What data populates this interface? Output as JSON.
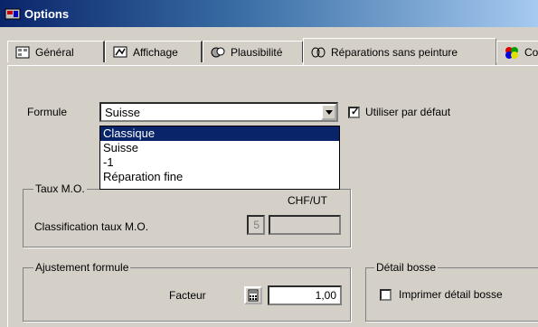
{
  "window": {
    "title": "Options"
  },
  "tabs": [
    {
      "label": "Général",
      "icon": "general-icon"
    },
    {
      "label": "Affichage",
      "icon": "display-icon"
    },
    {
      "label": "Plausibilité",
      "icon": "plausibility-icon"
    },
    {
      "label": "Réparations sans peinture",
      "icon": "repair-icon",
      "active": true
    },
    {
      "label": "Co",
      "icon": "color-icon"
    }
  ],
  "formule": {
    "label": "Formule",
    "value": "Suisse",
    "options": [
      "Classique",
      "Suisse",
      "-1",
      "Réparation fine"
    ],
    "highlighted": "Classique",
    "default_checkbox": {
      "label": "Utiliser par défaut",
      "checked": true,
      "mark": "✓"
    }
  },
  "taux_mo": {
    "title": "Taux M.O.",
    "unit_header": "CHF/UT",
    "classification_label": "Classification taux M.O.",
    "classification_value": "5"
  },
  "ajustement": {
    "title": "Ajustement formule",
    "facteur_label": "Facteur",
    "facteur_value": "1,00"
  },
  "detail_bosse": {
    "title": "Détail bosse",
    "checkbox_label": "Imprimer détail bosse",
    "checked": false
  },
  "colors": {
    "title_gradient_start": "#0a246a",
    "selection": "#0a246a",
    "face": "#d4d0c8"
  }
}
